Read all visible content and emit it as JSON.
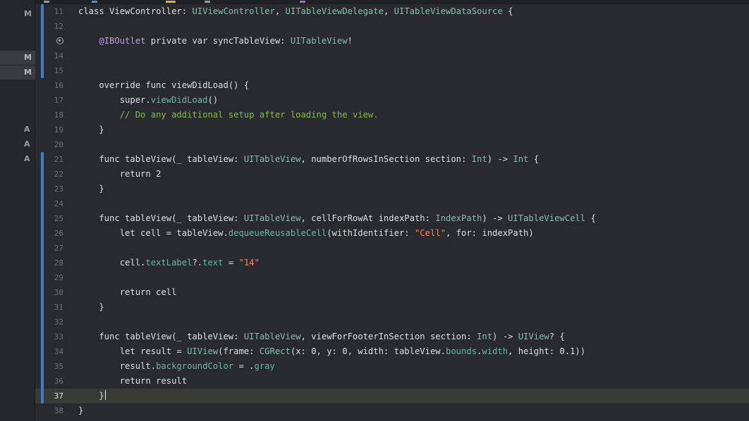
{
  "navigator": {
    "badges": [
      {
        "label": "M",
        "highlighted": false
      },
      {
        "label": "M",
        "highlighted": true
      },
      {
        "label": "M",
        "highlighted": true
      },
      {
        "label": "A",
        "highlighted": false
      },
      {
        "label": "A",
        "highlighted": false
      },
      {
        "label": "A",
        "highlighted": false
      }
    ]
  },
  "editor": {
    "current_line": 37,
    "changed_ranges": [
      [
        11,
        15
      ],
      [
        21,
        37
      ]
    ],
    "breakpoint_line": 13,
    "lines": [
      {
        "num": "11",
        "tokens": [
          [
            "kw",
            "class "
          ],
          [
            "",
            "ViewController: "
          ],
          [
            "ty",
            "UIViewController"
          ],
          [
            "",
            ", "
          ],
          [
            "ty",
            "UITableViewDelegate"
          ],
          [
            "",
            ", "
          ],
          [
            "ty",
            "UITableViewDataSource"
          ],
          [
            "",
            " {"
          ]
        ]
      },
      {
        "num": "12",
        "tokens": []
      },
      {
        "num": "13",
        "tokens": [
          [
            "",
            "    "
          ],
          [
            "at",
            "@IBOutlet"
          ],
          [
            "",
            " private var syncTableView: "
          ],
          [
            "ty",
            "UITableView"
          ],
          [
            "",
            "!"
          ]
        ]
      },
      {
        "num": "14",
        "tokens": []
      },
      {
        "num": "15",
        "tokens": []
      },
      {
        "num": "16",
        "tokens": [
          [
            "",
            "    override func viewDidLoad() {"
          ]
        ]
      },
      {
        "num": "17",
        "tokens": [
          [
            "",
            "        super."
          ],
          [
            "fn",
            "viewDidLoad"
          ],
          [
            "",
            "()"
          ]
        ]
      },
      {
        "num": "18",
        "tokens": [
          [
            "",
            "        "
          ],
          [
            "cm",
            "// Do any additional setup after loading the view."
          ]
        ]
      },
      {
        "num": "19",
        "tokens": [
          [
            "",
            "    }"
          ]
        ]
      },
      {
        "num": "20",
        "tokens": []
      },
      {
        "num": "21",
        "tokens": [
          [
            "",
            "    func tableView(_ tableView: "
          ],
          [
            "ty",
            "UITableView"
          ],
          [
            "",
            ", numberOfRowsInSection section: "
          ],
          [
            "ty",
            "Int"
          ],
          [
            "",
            ") -> "
          ],
          [
            "ty",
            "Int"
          ],
          [
            "",
            " {"
          ]
        ]
      },
      {
        "num": "22",
        "tokens": [
          [
            "",
            "        return 2"
          ]
        ]
      },
      {
        "num": "23",
        "tokens": [
          [
            "",
            "    }"
          ]
        ]
      },
      {
        "num": "24",
        "tokens": []
      },
      {
        "num": "25",
        "tokens": [
          [
            "",
            "    func tableView(_ tableView: "
          ],
          [
            "ty",
            "UITableView"
          ],
          [
            "",
            ", cellForRowAt indexPath: "
          ],
          [
            "ty",
            "IndexPath"
          ],
          [
            "",
            ") -> "
          ],
          [
            "ty",
            "UITableViewCell"
          ],
          [
            "",
            " {"
          ]
        ]
      },
      {
        "num": "26",
        "tokens": [
          [
            "",
            "        let cell = tableView."
          ],
          [
            "fn",
            "dequeueReusableCell"
          ],
          [
            "",
            "(withIdentifier: "
          ],
          [
            "st",
            "\"Cell\""
          ],
          [
            "",
            ", for: indexPath)"
          ]
        ]
      },
      {
        "num": "27",
        "tokens": []
      },
      {
        "num": "28",
        "tokens": [
          [
            "",
            "        cell."
          ],
          [
            "fn",
            "textLabel"
          ],
          [
            "",
            "?."
          ],
          [
            "fn",
            "text"
          ],
          [
            "",
            " = "
          ],
          [
            "st",
            "\"14\""
          ]
        ]
      },
      {
        "num": "29",
        "tokens": []
      },
      {
        "num": "30",
        "tokens": [
          [
            "",
            "        return cell"
          ]
        ]
      },
      {
        "num": "31",
        "tokens": [
          [
            "",
            "    }"
          ]
        ]
      },
      {
        "num": "32",
        "tokens": []
      },
      {
        "num": "33",
        "tokens": [
          [
            "",
            "    func tableView(_ tableView: "
          ],
          [
            "ty",
            "UITableView"
          ],
          [
            "",
            ", viewForFooterInSection section: "
          ],
          [
            "ty",
            "Int"
          ],
          [
            "",
            ") -> "
          ],
          [
            "ty",
            "UIView"
          ],
          [
            "",
            "? {"
          ]
        ]
      },
      {
        "num": "34",
        "tokens": [
          [
            "",
            "        let result = "
          ],
          [
            "ty",
            "UIView"
          ],
          [
            "",
            "(frame: "
          ],
          [
            "ty",
            "CGRect"
          ],
          [
            "",
            "(x: 0, y: 0, width: tableView."
          ],
          [
            "fn",
            "bounds"
          ],
          [
            "",
            "."
          ],
          [
            "fn",
            "width"
          ],
          [
            "",
            ", height: 0.1))"
          ]
        ]
      },
      {
        "num": "35",
        "tokens": [
          [
            "",
            "        result."
          ],
          [
            "fn",
            "backgroundColor"
          ],
          [
            "",
            " = ."
          ],
          [
            "fn",
            "gray"
          ]
        ]
      },
      {
        "num": "36",
        "tokens": [
          [
            "",
            "        return result"
          ]
        ]
      },
      {
        "num": "37",
        "tokens": [
          [
            "",
            "    }"
          ]
        ]
      },
      {
        "num": "38",
        "tokens": [
          [
            "",
            "}"
          ]
        ]
      }
    ]
  }
}
